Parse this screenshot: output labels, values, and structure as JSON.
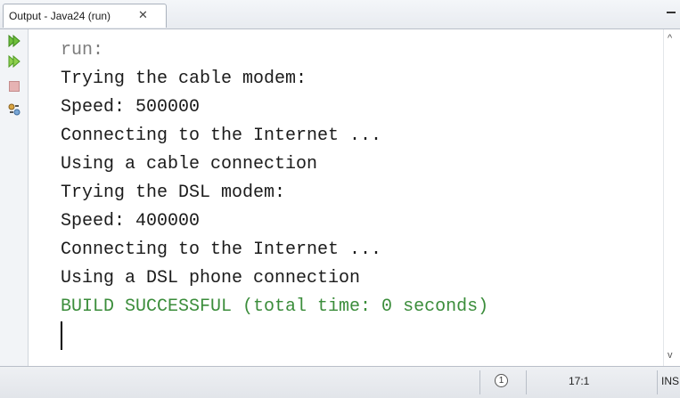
{
  "tab": {
    "title": "Output - Java24 (run)",
    "close_glyph": "✕"
  },
  "toolbar": {
    "icons": [
      "rerun-icon",
      "rerun-with-options-icon",
      "stop-icon",
      "settings-icon"
    ]
  },
  "output": {
    "lines": [
      "run:",
      "Trying the cable modem:",
      "Speed: 500000",
      "Connecting to the Internet ...",
      "Using a cable connection",
      "Trying the DSL modem:",
      "Speed: 400000",
      "Connecting to the Internet ...",
      "Using a DSL phone connection",
      "BUILD SUCCESSFUL (total time: 0 seconds)"
    ]
  },
  "scrollbar": {
    "up": "^",
    "down": "v"
  },
  "status": {
    "notification": "1",
    "position": "17:1",
    "mode": "INS"
  },
  "colors": {
    "text": "#1b1b1b",
    "run_label": "#7d7d7d",
    "build_success": "#3b8d3b"
  }
}
